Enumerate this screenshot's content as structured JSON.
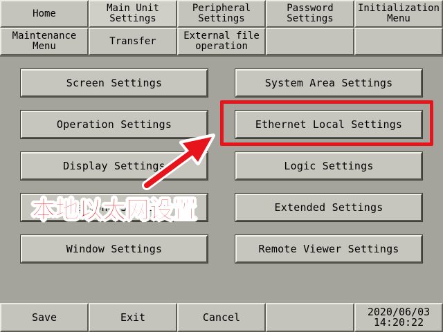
{
  "tabs_row1": [
    {
      "label": "Home"
    },
    {
      "label": "Main Unit\nSettings"
    },
    {
      "label": "Peripheral\nSettings"
    },
    {
      "label": "Password\nSettings"
    },
    {
      "label": "Initialization\nMenu"
    }
  ],
  "tabs_row2": [
    {
      "label": "Maintenance\nMenu"
    },
    {
      "label": "Transfer"
    },
    {
      "label": "External file\noperation"
    },
    {
      "label": ""
    },
    {
      "label": ""
    }
  ],
  "settings_left": [
    {
      "label": "Screen Settings"
    },
    {
      "label": "Operation Settings"
    },
    {
      "label": "Display Settings"
    },
    {
      "label": "Time Zone Settings"
    },
    {
      "label": "Window Settings"
    }
  ],
  "settings_right": [
    {
      "label": "System Area Settings"
    },
    {
      "label": "Ethernet Local Settings"
    },
    {
      "label": "Logic Settings"
    },
    {
      "label": "Extended Settings"
    },
    {
      "label": "Remote Viewer Settings"
    }
  ],
  "bottom_bar": {
    "save_label": "Save",
    "exit_label": "Exit",
    "cancel_label": "Cancel",
    "date": "2020/06/03",
    "time": "14:20:22"
  },
  "annotation": {
    "label": "本地以太网设置",
    "color": "#e8141c"
  }
}
